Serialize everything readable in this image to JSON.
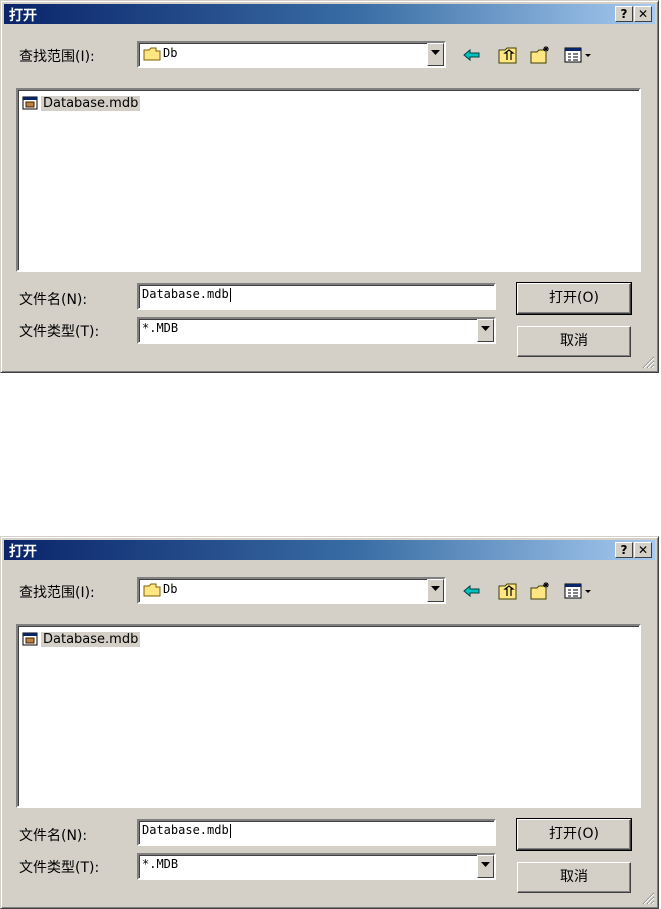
{
  "dialogs": [
    {
      "title": "打开",
      "look_in_label": "查找范围(I):",
      "look_in_value": "Db",
      "files": [
        "Database.mdb"
      ],
      "filename_label": "文件名(N):",
      "filename_value": "Database.mdb",
      "filetype_label": "文件类型(T):",
      "filetype_value": "*.MDB",
      "open_button": "打开(O)",
      "cancel_button": "取消"
    },
    {
      "title": "打开",
      "look_in_label": "查找范围(I):",
      "look_in_value": "Db",
      "files": [
        "Database.mdb"
      ],
      "filename_label": "文件名(N):",
      "filename_value": "Database.mdb",
      "filetype_label": "文件类型(T):",
      "filetype_value": "*.MDB",
      "open_button": "打开(O)",
      "cancel_button": "取消"
    }
  ],
  "icons": [
    "help-icon",
    "close-icon",
    "folder-icon",
    "dropdown-arrow-icon",
    "back-arrow-icon",
    "up-folder-icon",
    "new-folder-icon",
    "view-menu-icon",
    "database-file-icon",
    "resize-grip-icon"
  ],
  "colors": {
    "face": "#d4d0c8",
    "title_start": "#0a246a",
    "title_end": "#a6caf0"
  }
}
